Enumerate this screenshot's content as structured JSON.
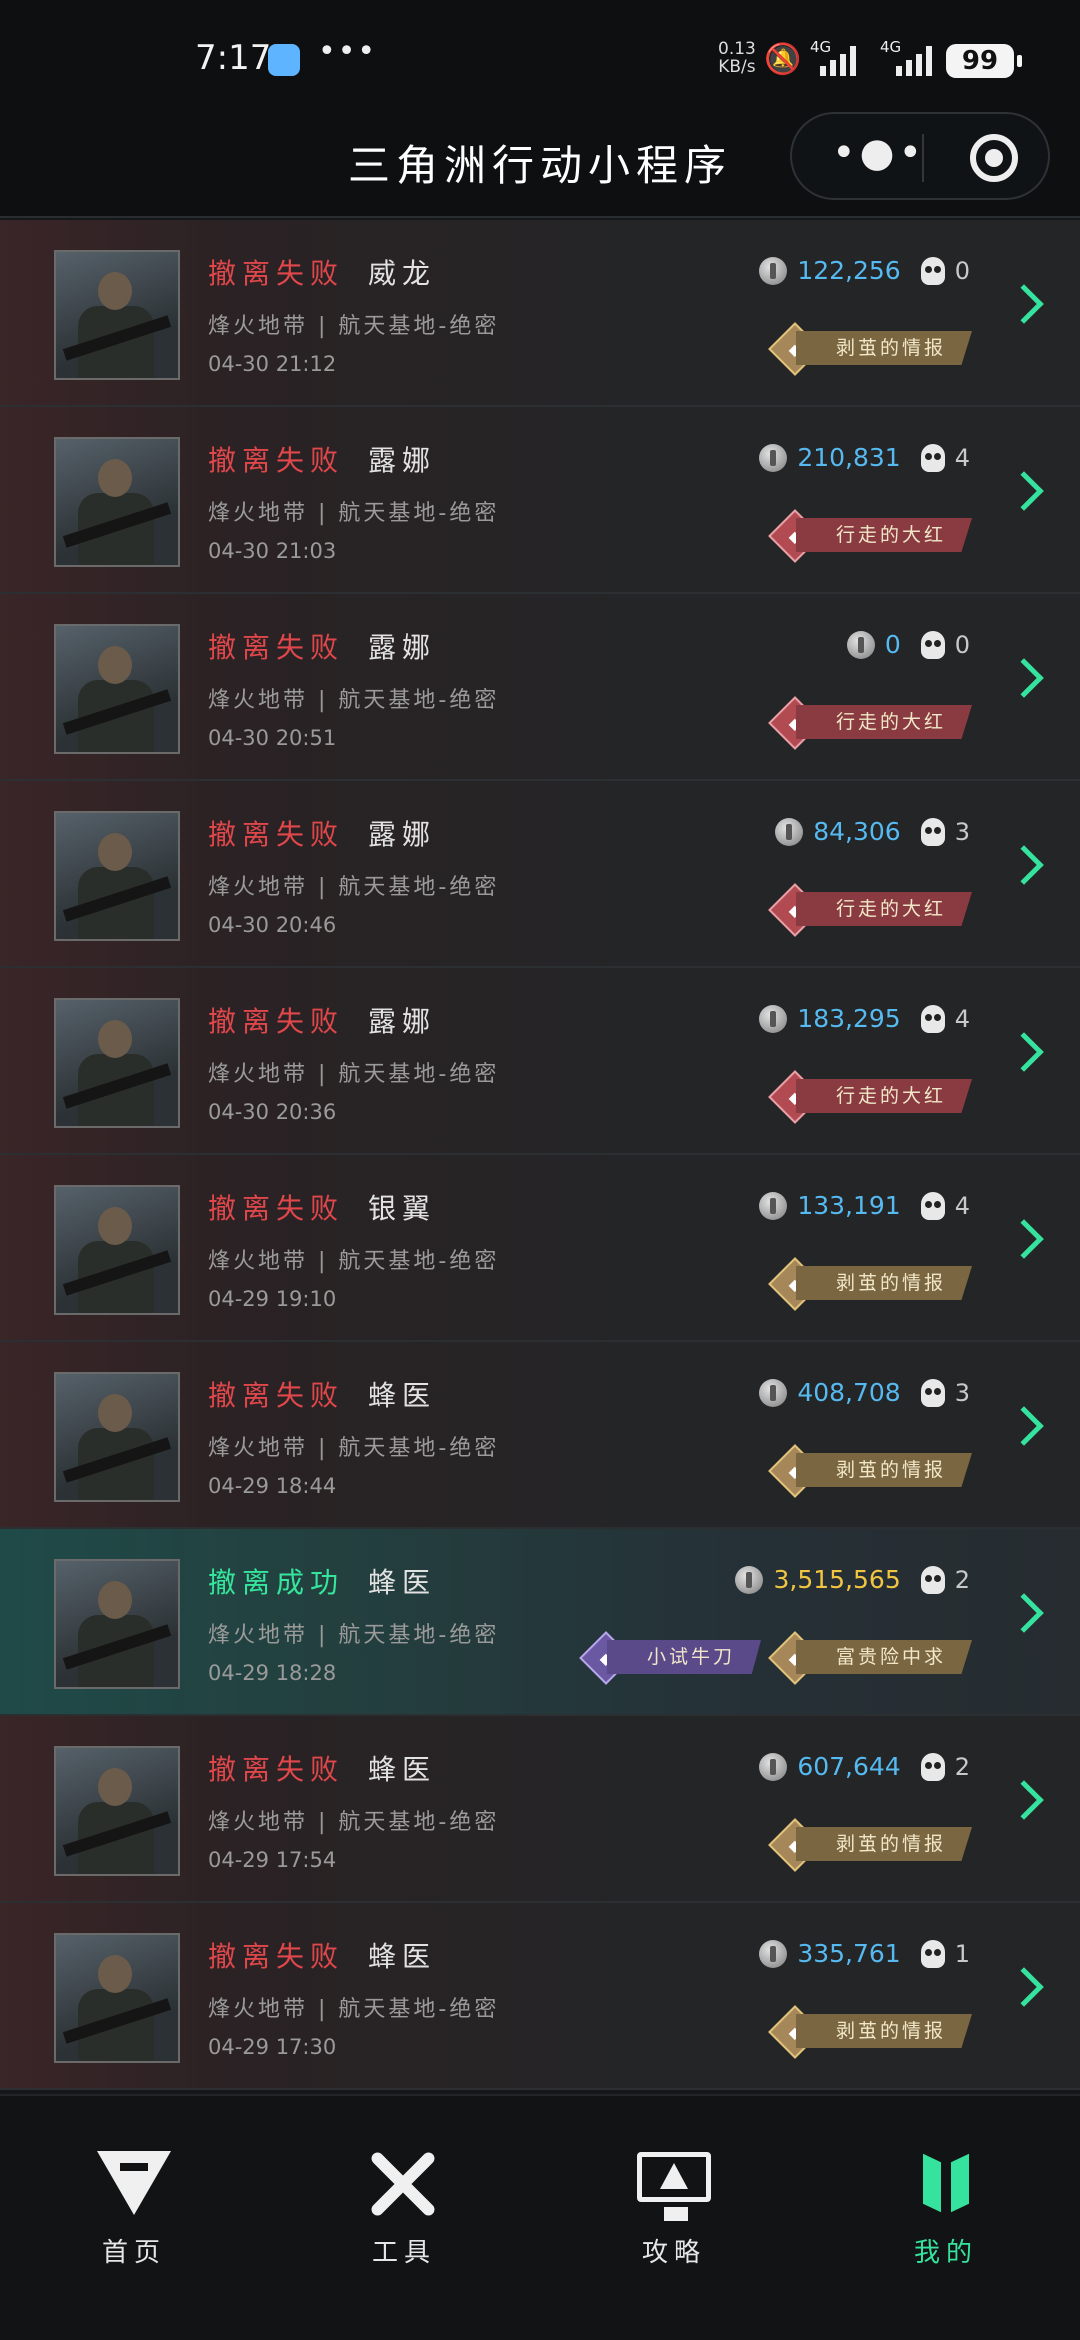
{
  "status_bar": {
    "time": "7:17",
    "net_speed_value": "0.13",
    "net_speed_unit": "KB/s",
    "sim1": "4G",
    "sim2": "4G",
    "battery": "99"
  },
  "header": {
    "title": "三角洲行动小程序",
    "more_icon": "more-icon",
    "close_icon": "target-icon"
  },
  "records": [
    {
      "status": "撤离失败",
      "result": "fail",
      "operator": "威龙",
      "mode": "烽火地带 | 航天基地-绝密",
      "date": "04-30 21:12",
      "value": "122,256",
      "kills": "0",
      "badges": [
        {
          "label": "剥茧的情报",
          "style": "gold"
        }
      ]
    },
    {
      "status": "撤离失败",
      "result": "fail",
      "operator": "露娜",
      "mode": "烽火地带 | 航天基地-绝密",
      "date": "04-30 21:03",
      "value": "210,831",
      "kills": "4",
      "badges": [
        {
          "label": "行走的大红",
          "style": "red"
        }
      ]
    },
    {
      "status": "撤离失败",
      "result": "fail",
      "operator": "露娜",
      "mode": "烽火地带 | 航天基地-绝密",
      "date": "04-30 20:51",
      "value": "0",
      "kills": "0",
      "badges": [
        {
          "label": "行走的大红",
          "style": "red"
        }
      ]
    },
    {
      "status": "撤离失败",
      "result": "fail",
      "operator": "露娜",
      "mode": "烽火地带 | 航天基地-绝密",
      "date": "04-30 20:46",
      "value": "84,306",
      "kills": "3",
      "badges": [
        {
          "label": "行走的大红",
          "style": "red"
        }
      ]
    },
    {
      "status": "撤离失败",
      "result": "fail",
      "operator": "露娜",
      "mode": "烽火地带 | 航天基地-绝密",
      "date": "04-30 20:36",
      "value": "183,295",
      "kills": "4",
      "badges": [
        {
          "label": "行走的大红",
          "style": "red"
        }
      ]
    },
    {
      "status": "撤离失败",
      "result": "fail",
      "operator": "银翼",
      "mode": "烽火地带 | 航天基地-绝密",
      "date": "04-29 19:10",
      "value": "133,191",
      "kills": "4",
      "badges": [
        {
          "label": "剥茧的情报",
          "style": "gold"
        }
      ]
    },
    {
      "status": "撤离失败",
      "result": "fail",
      "operator": "蜂医",
      "mode": "烽火地带 | 航天基地-绝密",
      "date": "04-29 18:44",
      "value": "408,708",
      "kills": "3",
      "badges": [
        {
          "label": "剥茧的情报",
          "style": "gold"
        }
      ]
    },
    {
      "status": "撤离成功",
      "result": "ok",
      "operator": "蜂医",
      "mode": "烽火地带 | 航天基地-绝密",
      "date": "04-29 18:28",
      "value": "3,515,565",
      "kills": "2",
      "badges": [
        {
          "label": "小试牛刀",
          "style": "purple"
        },
        {
          "label": "富贵险中求",
          "style": "gold"
        }
      ]
    },
    {
      "status": "撤离失败",
      "result": "fail",
      "operator": "蜂医",
      "mode": "烽火地带 | 航天基地-绝密",
      "date": "04-29 17:54",
      "value": "607,644",
      "kills": "2",
      "badges": [
        {
          "label": "剥茧的情报",
          "style": "gold"
        }
      ]
    },
    {
      "status": "撤离失败",
      "result": "fail",
      "operator": "蜂医",
      "mode": "烽火地带 | 航天基地-绝密",
      "date": "04-29 17:30",
      "value": "335,761",
      "kills": "1",
      "badges": [
        {
          "label": "剥茧的情报",
          "style": "gold"
        }
      ]
    }
  ],
  "nav": [
    {
      "label": "首页",
      "icon": "home-icon",
      "active": false
    },
    {
      "label": "工具",
      "icon": "tools-icon",
      "active": false
    },
    {
      "label": "攻略",
      "icon": "guide-icon",
      "active": false
    },
    {
      "label": "我的",
      "icon": "profile-icon",
      "active": true
    }
  ],
  "colors": {
    "fail": "#e0474b",
    "success": "#35e59b",
    "accent": "#36e39e",
    "value": "#56b9f0",
    "value_gold": "#f1c542"
  }
}
